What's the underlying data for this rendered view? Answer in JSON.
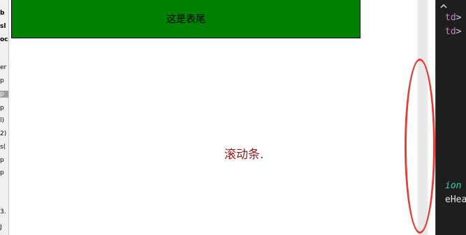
{
  "sidebar": {
    "fragments": [
      "b",
      "sl",
      "oc",
      "er",
      "p",
      "p",
      "p",
      "l)",
      "2)",
      "s(",
      "p",
      "p",
      "3.",
      "J"
    ]
  },
  "page": {
    "footer_text": "这是表尾",
    "caption": "滚动条."
  },
  "editor": {
    "lines": [
      {
        "tag": "td",
        "suffix": ">"
      },
      {
        "tag": "td",
        "suffix": ">"
      }
    ],
    "keyword_fragment": "ion",
    "identifier_fragment": "eHea"
  },
  "colors": {
    "footer_bg": "#008000",
    "annotation": "#e0403a",
    "caption": "#8b1a1a"
  }
}
